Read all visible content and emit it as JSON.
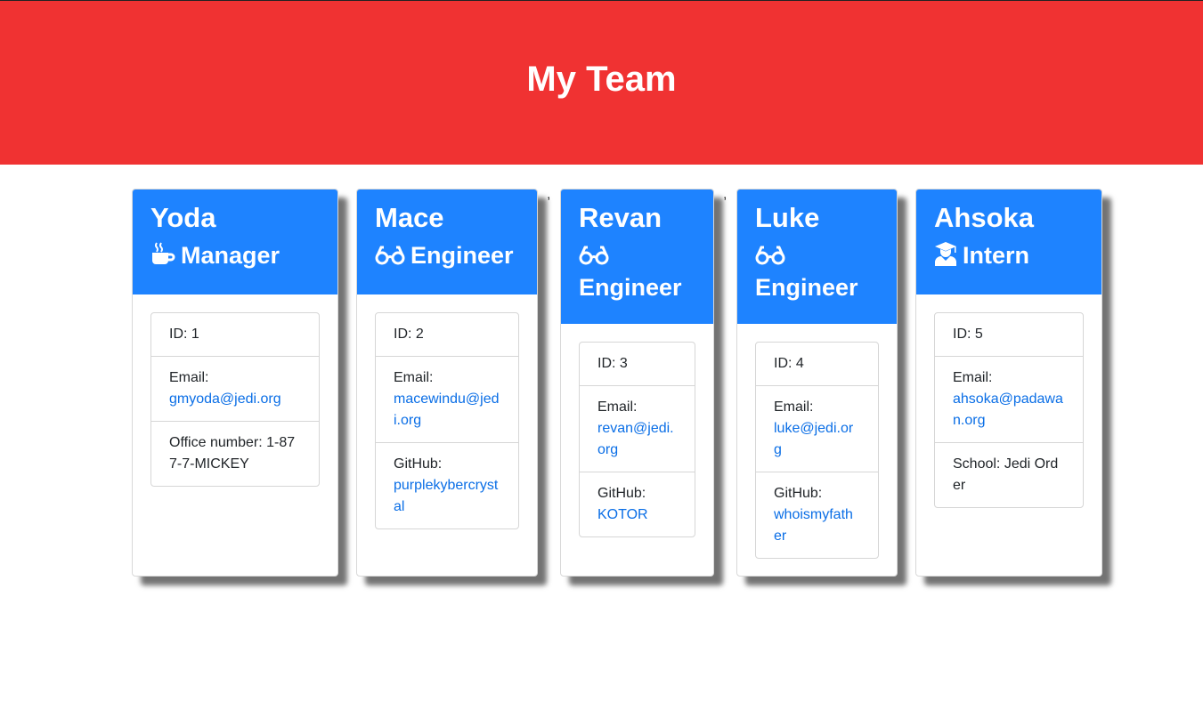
{
  "header": {
    "title": "My Team"
  },
  "separators": [
    ",",
    ","
  ],
  "members": [
    {
      "name": "Yoda",
      "role": "Manager",
      "icon": "coffee-icon",
      "id_text": "ID: 1",
      "email_label": "Email:",
      "email": "gmyoda@jedi.org",
      "extra_label": "Office number: 1-877-7-MICKEY",
      "extra_value": ""
    },
    {
      "name": "Mace",
      "role": "Engineer",
      "icon": "glasses-icon",
      "id_text": "ID: 2",
      "email_label": "Email:",
      "email": "macewindu@jedi.org",
      "extra_label": "GitHub:",
      "extra_value": "purplekybercrystal"
    },
    {
      "name": "Revan",
      "role": "Engineer",
      "icon": "glasses-icon",
      "id_text": "ID: 3",
      "email_label": "Email:",
      "email": "revan@jedi.org",
      "extra_label": "GitHub:",
      "extra_value": "KOTOR"
    },
    {
      "name": "Luke",
      "role": "Engineer",
      "icon": "glasses-icon",
      "id_text": "ID: 4",
      "email_label": "Email:",
      "email": "luke@jedi.org",
      "extra_label": "GitHub:",
      "extra_value": "whoismyfather"
    },
    {
      "name": "Ahsoka",
      "role": "Intern",
      "icon": "graduate-icon",
      "id_text": "ID: 5",
      "email_label": "Email:",
      "email": "ahsoka@padawan.org",
      "extra_label": "School: Jedi Order",
      "extra_value": ""
    }
  ]
}
